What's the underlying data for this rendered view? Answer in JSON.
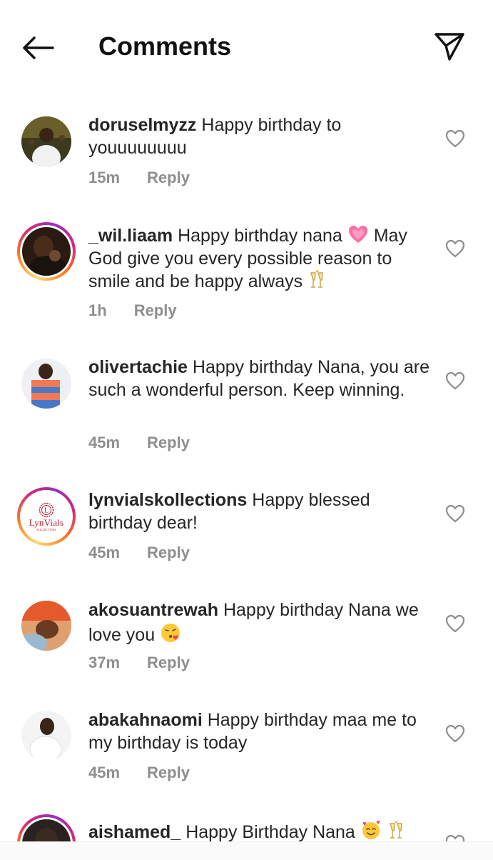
{
  "header": {
    "title": "Comments"
  },
  "comments": [
    {
      "username": "doruselmyzz",
      "text": " Happy birthday to youuuuuuuu",
      "time": "15m",
      "reply": "Reply"
    },
    {
      "username": "_wil.liaam",
      "text": " Happy birthday nana",
      "text2": "  May God give you every possible reason to smile and be happy always",
      "time": "1h",
      "reply": "Reply"
    },
    {
      "username": "olivertachie",
      "text": " Happy birthday Nana, you are such a wonderful person. Keep winning.",
      "time": "45m",
      "reply": "Reply"
    },
    {
      "username": "lynvialskollections",
      "text": " Happy blessed birthday dear!",
      "time": "45m",
      "reply": "Reply",
      "avatar_logo": "LynVials",
      "avatar_logo_sub": "KOLLECTIONS",
      "avatar_logo_letter": "L"
    },
    {
      "username": "akosuantrewah",
      "text": " Happy birthday Nana we love you ",
      "time": "37m",
      "reply": "Reply"
    },
    {
      "username": "abakahnaomi",
      "text": " Happy birthday maa me to my birthday is today",
      "time": "45m",
      "reply": "Reply"
    },
    {
      "username": "aishamed_",
      "text": " Happy Birthday Nana "
    }
  ],
  "colors": {
    "text": "#262626",
    "meta": "#8e8e8e",
    "story_ring": [
      "#feda75",
      "#fa7e1e",
      "#d62976",
      "#962fbf"
    ]
  },
  "icons": {
    "back": "arrow-left-icon",
    "send": "paper-plane-icon",
    "like": "heart-outline-icon"
  }
}
